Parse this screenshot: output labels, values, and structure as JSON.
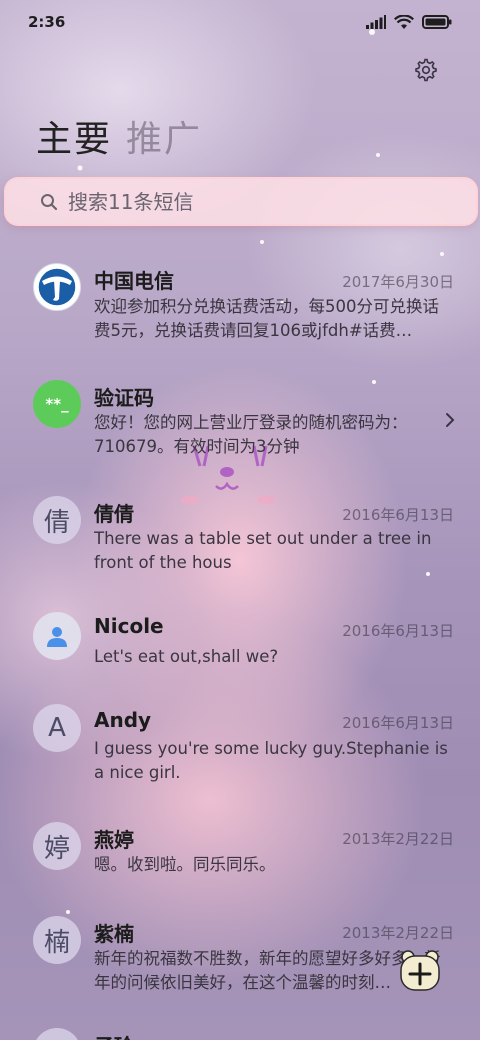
{
  "status_bar": {
    "time": "2:36"
  },
  "tabs": {
    "main": "主要",
    "promo": "推广"
  },
  "search": {
    "placeholder": "搜索11条短信"
  },
  "conversations": [
    {
      "name": "中国电信",
      "date": "2017年6月30日",
      "preview": "欢迎参加积分兑换话费活动，每500分可兑换话费5元，兑换话费请回复106或jfdh#话费…",
      "avatar": "telecom-logo"
    },
    {
      "name": "验证码",
      "date": "",
      "preview": "您好！您的网上营业厅登录的随机密码为：710679。有效时间为3分钟",
      "avatar_text": "**_"
    },
    {
      "name": "倩倩",
      "date": "2016年6月13日",
      "preview": "There was a table set out under a tree in front of the hous",
      "avatar_text": "倩"
    },
    {
      "name": "Nicole",
      "date": "2016年6月13日",
      "preview": "Let's eat out,shall we?",
      "avatar": "person-icon"
    },
    {
      "name": "Andy",
      "date": "2016年6月13日",
      "preview": "I guess you're some lucky guy.Stephanie is a nice girl.",
      "avatar_text": "A"
    },
    {
      "name": "燕婷",
      "date": "2013年2月22日",
      "preview": "嗯。收到啦。同乐同乐。",
      "avatar_text": "婷"
    },
    {
      "name": "紫楠",
      "date": "2013年2月22日",
      "preview": "新年的祝福数不胜数，新年的愿望好多好多，新年的问候依旧美好，在这个温馨的时刻…",
      "avatar_text": "楠"
    },
    {
      "name": "子玲",
      "date": "",
      "preview": "",
      "avatar_text": ""
    }
  ],
  "colors": {
    "verify_green": "#5ccb5a",
    "telecom_blue": "#1a5ea8",
    "search_bg": "#ffe1e6"
  }
}
